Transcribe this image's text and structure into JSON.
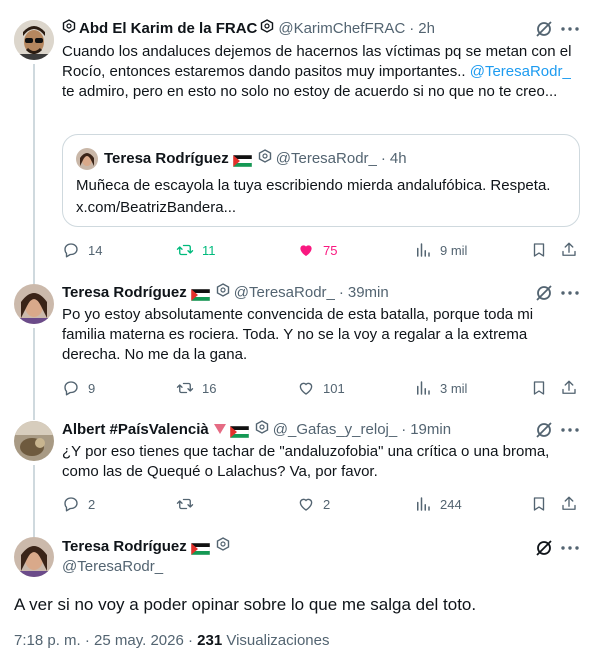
{
  "tweets": [
    {
      "name": "Abd El Karim de la FRAC",
      "name_prefix_icon": "hexagon-emblem-icon",
      "name_suffix_icon": "hexagon-emblem-icon",
      "handle": "@KarimChefFRAC",
      "time": "2h",
      "text_1": "Cuando los andaluces dejemos de hacernos las víctimas pq se metan con el Rocío, entonces estaremos dando pasitos muy importantes..",
      "mention": "@TeresaRodr_",
      "text_2": " te admiro, pero en esto no solo no estoy de acuerdo si no que no te creo...",
      "quote": {
        "name": "Teresa Rodríguez",
        "flag": "palestine-flag-icon",
        "handle": "@TeresaRodr_",
        "time": "4h",
        "text": "Muñeca de escayola la tuya escribiendo mierda andalufóbica. Respeta. x.com/BeatrizBandera..."
      },
      "stats": {
        "replies": "14",
        "retweets": "11",
        "likes": "75",
        "views": "9 mil"
      }
    },
    {
      "name": "Teresa Rodríguez",
      "handle": "@TeresaRodr_",
      "time": "39min",
      "text": "Po yo estoy absolutamente convencida de esta batalla, porque toda mi familia materna es rociera. Toda. Y no se la voy a regalar a la extrema derecha. No me da la gana.",
      "stats": {
        "replies": "9",
        "retweets": "16",
        "likes": "101",
        "views": "3 mil"
      }
    },
    {
      "name": "Albert #PaísValencià",
      "handle": "@_Gafas_y_reloj_",
      "time": "19min",
      "text": "¿Y por eso tienes que tachar de \"andaluzofobia\" una crítica o una broma, como las de Quequé o Lalachus? Va, por favor.",
      "stats": {
        "replies": "2",
        "retweets": "",
        "likes": "2",
        "views": "244"
      }
    }
  ],
  "main": {
    "name": "Teresa Rodríguez",
    "handle": "@TeresaRodr_",
    "text": "A ver si no voy a poder opinar sobre lo que me salga del toto.",
    "time_date": "7:18 p. m. · 25 may. 2026 · ",
    "views_count": "231",
    "views_label": " Visualizaciones"
  },
  "colors": {
    "accent": "#1d9bf0",
    "retweet": "#00ba7c",
    "like": "#f91880",
    "muted": "#536471",
    "border": "#cfd9de"
  }
}
